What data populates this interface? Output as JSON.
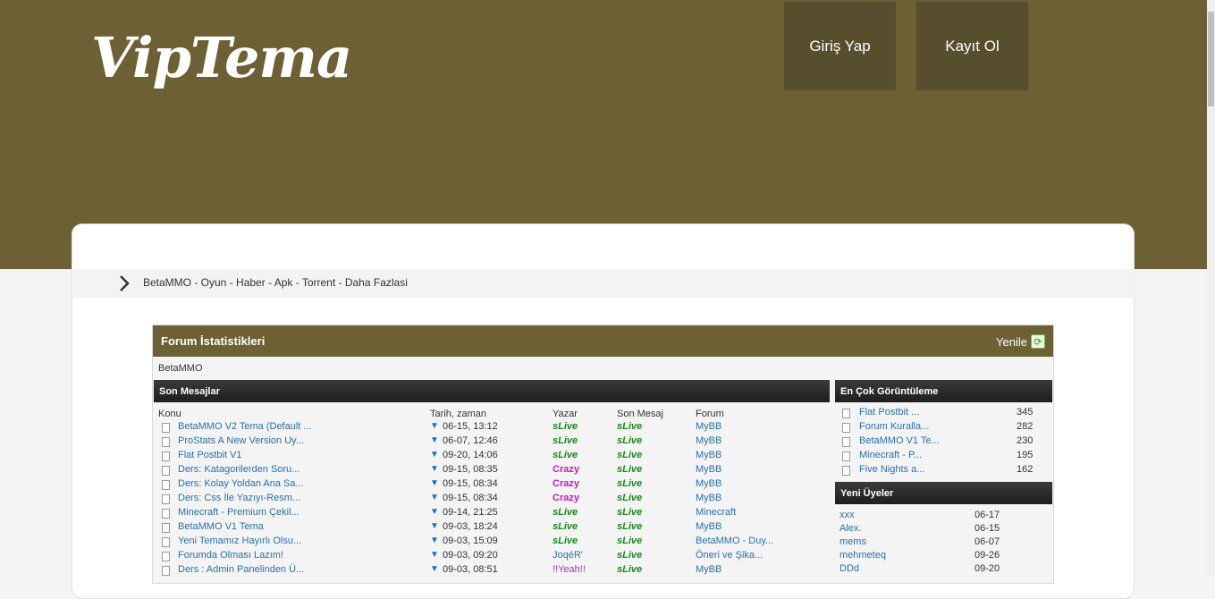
{
  "header": {
    "logo": "VipTema",
    "login_label": "Giriş Yap",
    "register_label": "Kayıt Ol",
    "bg_color": "#6c6034"
  },
  "nav": {
    "breadcrumb": "BetaMMO - Oyun - Haber - Apk - Torrent - Daha Fazlasi"
  },
  "stats": {
    "title": "Forum İstatistikleri",
    "refresh_label": "Yenile",
    "subtitle": "BetaMMO",
    "recent_title": "Son Mesajlar",
    "columns": [
      "Konu",
      "Tarih, zaman",
      "Yazar",
      "Son Mesaj",
      "Forum"
    ],
    "rows": [
      {
        "topic": "BetaMMO V2 Tema (Default ...",
        "date": "06-15, 13:12",
        "author": "sLive",
        "author_style": "slive",
        "last": "sLive",
        "forum": "MyBB"
      },
      {
        "topic": "ProStats A New Version Uy...",
        "date": "06-07, 12:46",
        "author": "sLive",
        "author_style": "slive",
        "last": "sLive",
        "forum": "MyBB"
      },
      {
        "topic": "Flat Postbit V1",
        "date": "09-20, 14:06",
        "author": "sLive",
        "author_style": "slive",
        "last": "sLive",
        "forum": "MyBB"
      },
      {
        "topic": "Ders: Katagorilerden Soru...",
        "date": "09-15, 08:35",
        "author": "Crazy",
        "author_style": "crazy",
        "last": "sLive",
        "forum": "MyBB"
      },
      {
        "topic": "Ders: Kolay Yoldan Ana Sa...",
        "date": "09-15, 08:34",
        "author": "Crazy",
        "author_style": "crazy",
        "last": "sLive",
        "forum": "MyBB"
      },
      {
        "topic": "Ders: Css İle Yazıyı-Resm...",
        "date": "09-15, 08:34",
        "author": "Crazy",
        "author_style": "crazy",
        "last": "sLive",
        "forum": "MyBB"
      },
      {
        "topic": "Minecraft - Premium Çekil...",
        "date": "09-14, 21:25",
        "author": "sLive",
        "author_style": "slive",
        "last": "sLive",
        "forum": "Minecraft"
      },
      {
        "topic": "BetaMMO V1 Tema",
        "date": "09-03, 18:24",
        "author": "sLive",
        "author_style": "slive",
        "last": "sLive",
        "forum": "MyBB"
      },
      {
        "topic": "Yeni Temamız Hayırlı Olsu...",
        "date": "09-03, 15:09",
        "author": "sLive",
        "author_style": "slive",
        "last": "sLive",
        "forum": "BetaMMO - Duy..."
      },
      {
        "topic": "Forumda Olması Lazım!",
        "date": "09-03, 09:20",
        "author": "JoqéR'",
        "author_style": "joqer",
        "last": "sLive",
        "forum": "Öneri ve Şika..."
      },
      {
        "topic": "Ders : Admin Panelinden Ü...",
        "date": "09-03, 08:51",
        "author": "!!Yeah!!",
        "author_style": "yeah",
        "last": "sLive",
        "forum": "MyBB"
      }
    ],
    "most_viewed_title": "En Çok Görüntüleme",
    "most_viewed": [
      {
        "title": "Flat Postbit ...",
        "count": "345"
      },
      {
        "title": "Forum Kuralla...",
        "count": "282"
      },
      {
        "title": "BetaMMO V1 Te...",
        "count": "230"
      },
      {
        "title": "Minecraft - P...",
        "count": "195"
      },
      {
        "title": "Five Nights a...",
        "count": "162"
      }
    ],
    "new_members_title": "Yeni Üyeler",
    "new_members": [
      {
        "name": "xxx",
        "date": "06-17"
      },
      {
        "name": "Alex.",
        "date": "06-15"
      },
      {
        "name": "mems",
        "date": "06-07"
      },
      {
        "name": "mehmeteq",
        "date": "09-26"
      },
      {
        "name": "DDd",
        "date": "09-20"
      }
    ]
  }
}
